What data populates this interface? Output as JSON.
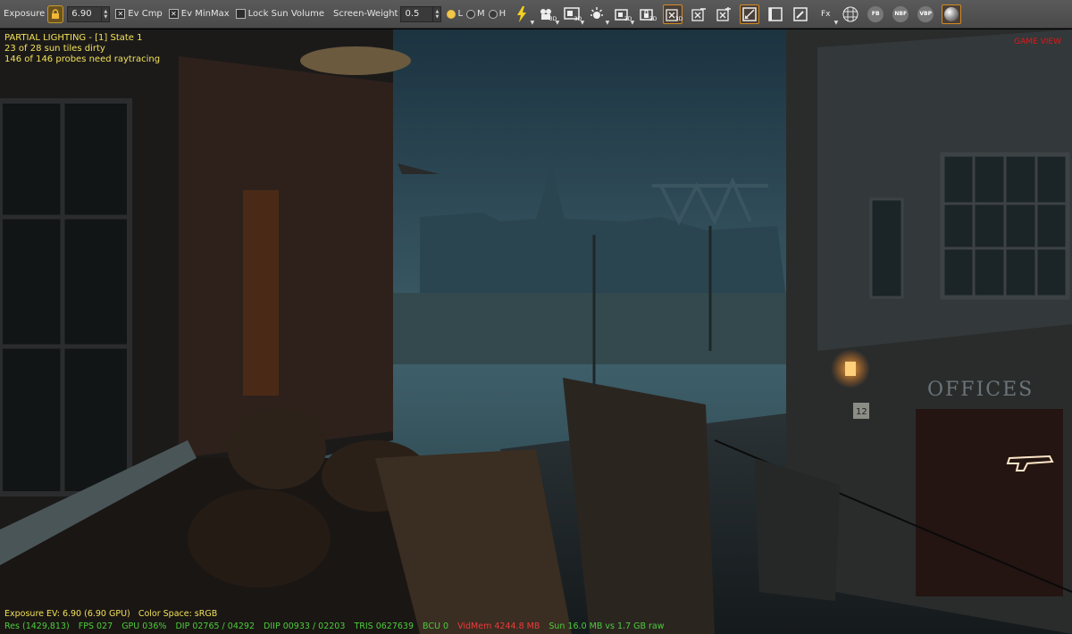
{
  "toolbar": {
    "exposure_label": "Exposure",
    "exposure_value": "6.90",
    "ev_cmp_label": "Ev Cmp",
    "ev_minmax_label": "Ev MinMax",
    "lock_sun_volume_label": "Lock Sun Volume",
    "screen_weight_label": "Screen-Weight",
    "screen_weight_value": "0.5",
    "radio_l": "L",
    "radio_m": "M",
    "radio_h": "H",
    "selected_radio": "L",
    "fb_badge": "FB",
    "nbf_badge": "NBF",
    "vbf_badge": "VBP",
    "fx_label": "Fx",
    "sub_3d": "3D",
    "icons": [
      "lock-icon",
      "lightning-icon",
      "camera-3d-icon",
      "screen-3d-icon",
      "sun-icon",
      "box-3d-icon",
      "box-lock-icon",
      "gizmo-3d-icon",
      "gizmo-minus-icon",
      "gizmo-plus-icon",
      "screen-edit-icon",
      "frame-icon",
      "pencil-icon",
      "fx-icon",
      "grid-icon",
      "fb-icon",
      "nbf-icon",
      "vbp-icon",
      "sphere-icon"
    ]
  },
  "viewport": {
    "lighting_status": "PARTIAL LIGHTING - [1] State 1",
    "sun_tiles": "23 of 28 sun tiles dirty",
    "probes": "146 of 146 probes need raytracing",
    "view_mode": "GAME VIEW",
    "exposure_ev": "Exposure EV: 6.90 (6.90 GPU)",
    "color_space": "Color Space: sRGB",
    "sign_text": "OFFICES",
    "sign_number": "12"
  },
  "stats": {
    "res": "Res (1429,813)",
    "fps": "FPS 027",
    "gpu": "GPU 036%",
    "dip": "DIP 02765 / 04292",
    "diip": "DIIP 00933 / 02203",
    "tris": "TRIS 0627639",
    "bcu": "BCU 0",
    "vidmem": "VidMem 4244.8 MB",
    "sun": "Sun 16.0 MB vs 1.7 GB raw"
  },
  "colors": {
    "toolbar_bg": "#4d4d4d",
    "highlight": "#d48a22",
    "stats_yellow": "#f2e25a",
    "stats_green": "#4ccc3c",
    "stats_red": "#f03a3a"
  }
}
